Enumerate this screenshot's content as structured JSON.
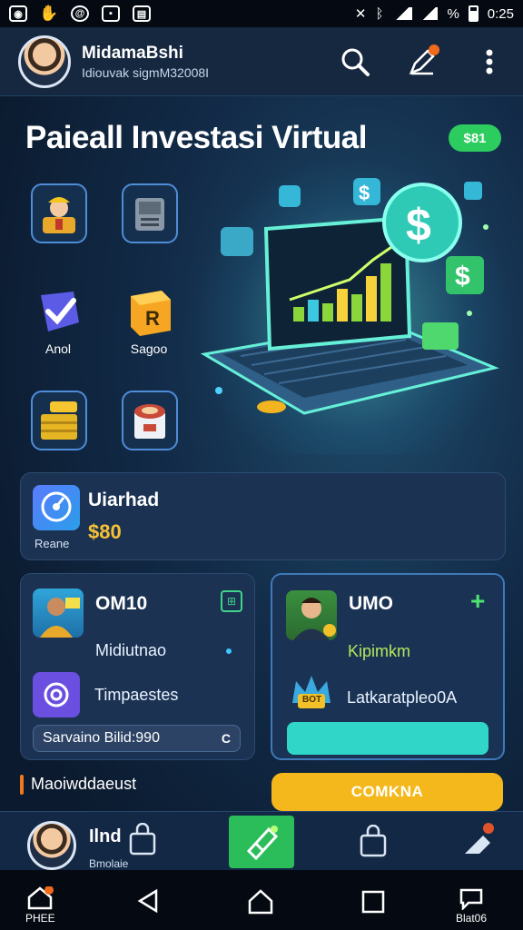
{
  "status_bar": {
    "time": "0:25",
    "percent": "%"
  },
  "header": {
    "user_name": "MidamaBshi",
    "user_id": "Idiouvak sigmM32008I",
    "icons": [
      "search-icon",
      "edit-icon",
      "more-icon"
    ]
  },
  "hero": {
    "title": "Paieall Investasi Virtual",
    "badge": "$81",
    "tiles": [
      {
        "icon": "worker-icon",
        "label": ""
      },
      {
        "icon": "safe-icon",
        "label": ""
      },
      {
        "icon": "check-shield-icon",
        "label": "Anol"
      },
      {
        "icon": "cube-icon",
        "label": "Sagoo"
      },
      {
        "icon": "gold-bars-icon",
        "label": ""
      },
      {
        "icon": "box-icon",
        "label": ""
      }
    ]
  },
  "summary": {
    "title": "Uiarhad",
    "value": "$80",
    "sub": "Reane"
  },
  "left_card": {
    "title": "OM10",
    "subtitle": "Midiutnao",
    "row_label": "Timpaestes",
    "field_text": "Sarvaino Bilid:990",
    "field_action": "C"
  },
  "right_card": {
    "title": "UMO",
    "subtitle": "Kipimkm",
    "row_label": "Latkaratpleo0A",
    "coin_label": "BOT"
  },
  "footer": {
    "label": "Maoiwddaeust",
    "cta": "COMKNA"
  },
  "tab_bar": {
    "name": "Ilnd",
    "sub": "Bmolaie"
  },
  "system_nav": {
    "home_label": "PHEE",
    "chat_label": "Blat06",
    "badge": "0"
  },
  "colors": {
    "accent_green": "#2ccc5f",
    "accent_gold": "#f5b81c",
    "teal": "#30d6c8",
    "card": "#1b3253"
  }
}
